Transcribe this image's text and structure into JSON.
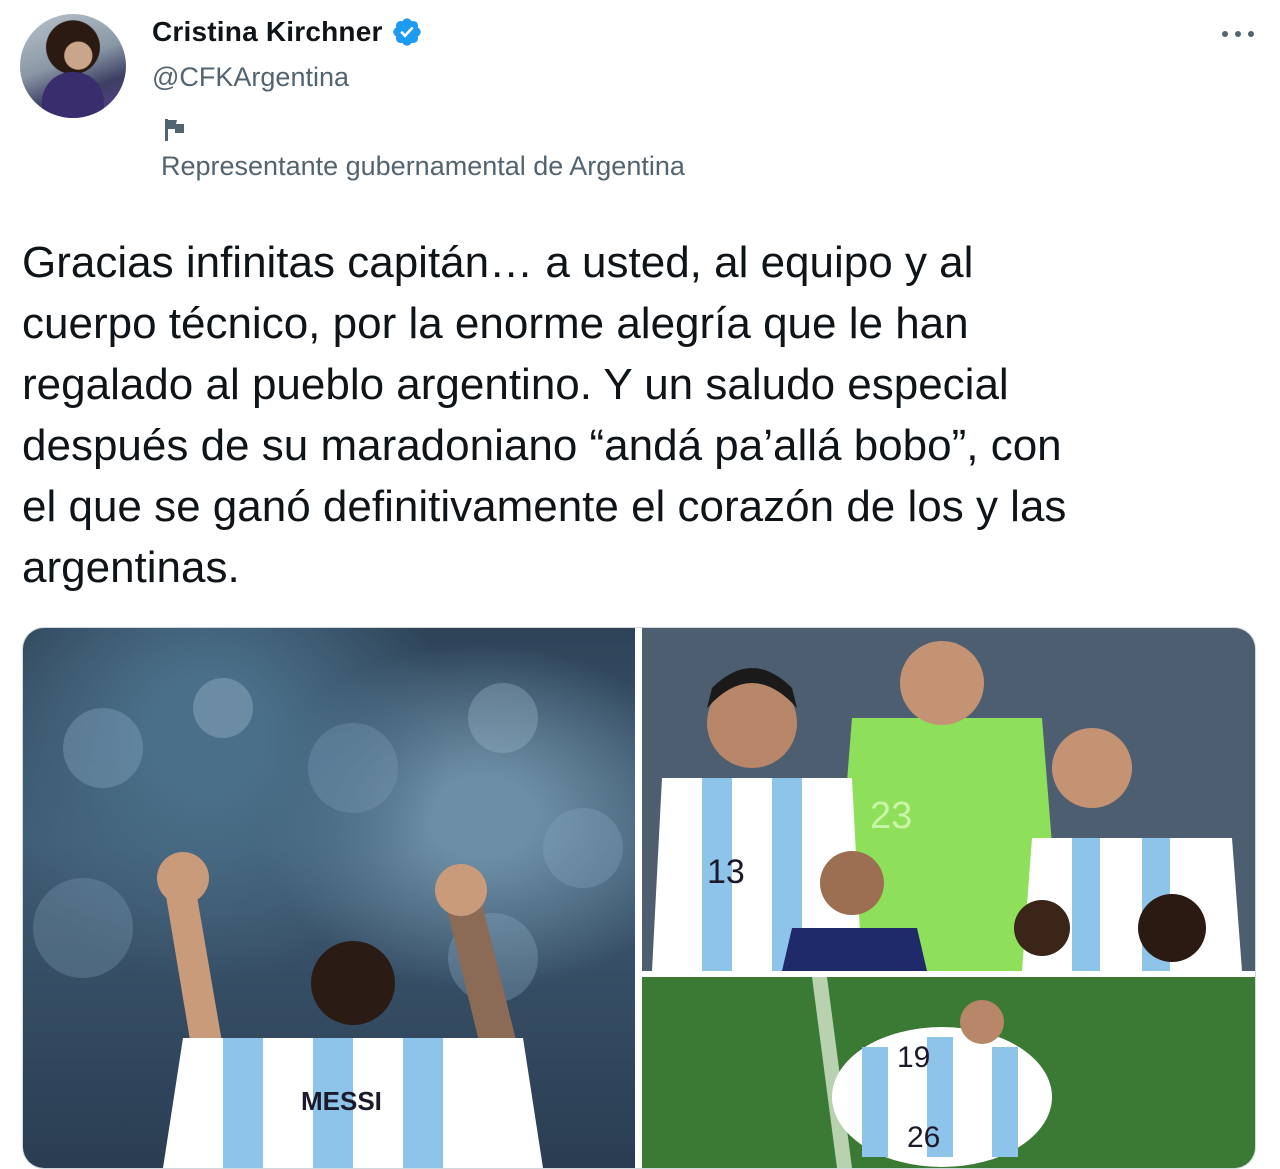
{
  "author": {
    "display_name": "Cristina Kirchner",
    "handle": "@CFKArgentina",
    "verified_icon": "verified-badge-icon",
    "label": "Representante gubernamental de Argentina",
    "label_icon": "flag-icon"
  },
  "tweet": {
    "text": "Gracias infinitas capitán… a usted, al equipo y al\ncuerpo técnico, por la enorme alegría que le han\nregalado al pueblo argentino. Y un saludo especial\ndespués de su maradoniano “andá pa’allá bobo”, con\nel que se ganó definitivamente el corazón de los y las\nargentinas."
  },
  "media": {
    "left": {
      "jersey_name": "MESSI"
    },
    "top_right": {
      "numbers": [
        "13",
        "23"
      ]
    },
    "bottom_right": {
      "numbers": [
        "19",
        "26"
      ]
    }
  },
  "colors": {
    "text_primary": "#0f1419",
    "text_secondary": "#536471",
    "verified_blue": "#1d9bf0"
  }
}
